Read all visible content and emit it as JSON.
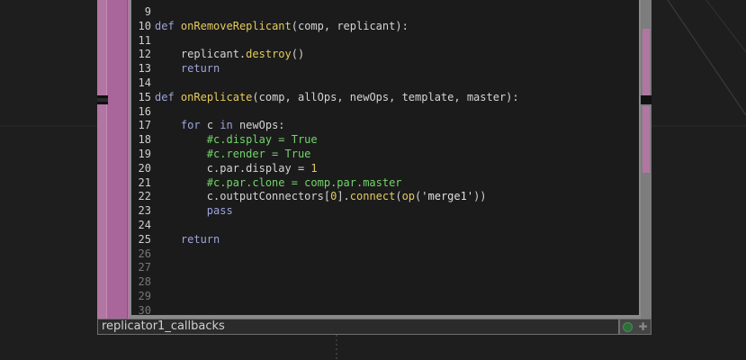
{
  "node": {
    "title": "replicator1_callbacks",
    "viewer_icon": "viewer-toggle-icon",
    "expand_icon": "plus-icon"
  },
  "code": {
    "lines": [
      {
        "n": "9",
        "text": ""
      },
      {
        "n": "10",
        "text": "def onRemoveReplicant(comp, replicant):"
      },
      {
        "n": "11",
        "text": ""
      },
      {
        "n": "12",
        "text": "    replicant.destroy()"
      },
      {
        "n": "13",
        "text": "    return"
      },
      {
        "n": "14",
        "text": ""
      },
      {
        "n": "15",
        "text": "def onReplicate(comp, allOps, newOps, template, master):"
      },
      {
        "n": "16",
        "text": ""
      },
      {
        "n": "17",
        "text": "    for c in newOps:"
      },
      {
        "n": "18",
        "text": "        #c.display = True"
      },
      {
        "n": "19",
        "text": "        #c.render = True"
      },
      {
        "n": "20",
        "text": "        c.par.display = 1"
      },
      {
        "n": "21",
        "text": "        #c.par.clone = comp.par.master"
      },
      {
        "n": "22",
        "text": "        c.outputConnectors[0].connect(op('merge1'))"
      },
      {
        "n": "23",
        "text": "        pass"
      },
      {
        "n": "24",
        "text": ""
      },
      {
        "n": "25",
        "text": "    return"
      },
      {
        "n": "26",
        "text": ""
      },
      {
        "n": "27",
        "text": ""
      },
      {
        "n": "28",
        "text": ""
      },
      {
        "n": "29",
        "text": ""
      },
      {
        "n": "30",
        "text": ""
      }
    ]
  },
  "colors": {
    "keyword": "#9ea4dc",
    "function": "#e4cb5c",
    "comment": "#74d36a",
    "node_strip": "#b276a3",
    "background": "#1e1e1e"
  }
}
